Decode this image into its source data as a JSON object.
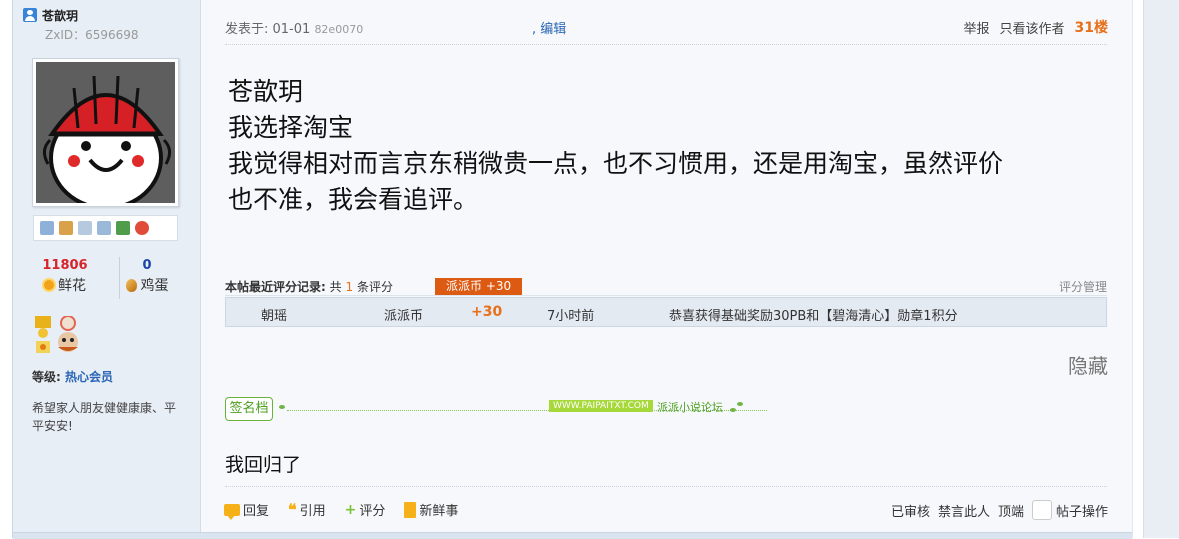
{
  "user": {
    "name": "苍歆玥",
    "zxid": "ZxID：6596698",
    "flowers_count": "11806",
    "flowers_label": "鲜花",
    "eggs_count": "0",
    "eggs_label": "鸡蛋",
    "level_label": "等级:",
    "level_value": "热心会员",
    "signature_short": "希望家人朋友健健康康、平平安安!"
  },
  "post": {
    "meta_prefix": "发表于: 01-01",
    "meta_hash": "82e0070",
    "edit_label": ", 编辑",
    "report_label": "举报",
    "only_author_label": "只看该作者",
    "floor_label": "31楼",
    "content_lines": [
      "苍歆玥",
      "我选择淘宝",
      "我觉得相对而言京东稍微贵一点，也不习惯用，还是用淘宝，虽然评价",
      "也不准，我会看追评。"
    ],
    "hide_label": "隐藏",
    "signature_text": "我回归了"
  },
  "rating": {
    "title": "本帖最近评分记录:",
    "count_prefix": "共",
    "count": "1",
    "count_suffix": "条评分",
    "badge": "派派币 +30",
    "manage_label": "评分管理",
    "row": {
      "user": "朝瑶",
      "currency": "派派币",
      "score": "+30",
      "time": "7小时前",
      "reason": "恭喜获得基础奖励30PB和【碧海清心】勋章1积分"
    }
  },
  "signature_banner": {
    "tag": "签名档",
    "url": "WWW.PAIPAITXT.COM",
    "site": "派派小说论坛"
  },
  "actions": {
    "reply": "回复",
    "quote": "引用",
    "rate": "评分",
    "news": "新鲜事",
    "reviewed": "已审核",
    "ban": "禁言此人",
    "top": "顶端",
    "post_ops": "帖子操作"
  },
  "colors": {
    "accent_orange": "#e8701a",
    "link_blue": "#2b66b5",
    "badge_orange": "#dd5a12"
  }
}
